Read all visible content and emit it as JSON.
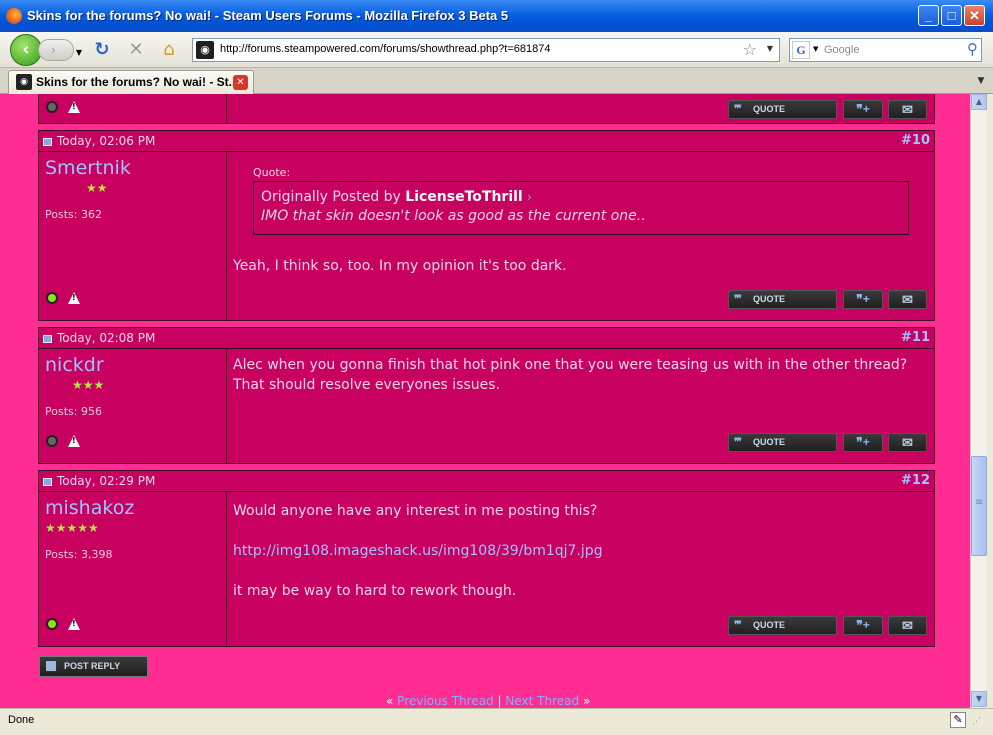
{
  "window": {
    "title": "Skins for the forums? No wai! - Steam Users Forums - Mozilla Firefox 3 Beta 5",
    "minimize": "_",
    "maximize": "□",
    "close": "✕"
  },
  "nav": {
    "url": "http://forums.steampowered.com/forums/showthread.php?t=681874",
    "search_placeholder": "Google"
  },
  "tab": {
    "label": "Skins for the forums? No wai! - St..."
  },
  "posts": [
    {
      "date": "Today, 02:06 PM",
      "number": "#10",
      "username": "Smertnik",
      "stars": "★★",
      "posts_label": "Posts: 362",
      "quote_label": "Quote:",
      "quote_prefix": "Originally Posted by",
      "quote_author": "LicenseToThrill",
      "quote_text": "IMO that skin doesn't look as good as the current one..",
      "body": "Yeah, I think so, too. In my opinion it's too dark.",
      "online": true
    },
    {
      "date": "Today, 02:08 PM",
      "number": "#11",
      "username": "nickdr",
      "stars": "★★★",
      "posts_label": "Posts: 956",
      "body_line1": "Alec when you gonna finish that hot pink one that you were teasing us with in the other thread?",
      "body_line2": "That should resolve everyones issues.",
      "online": false
    },
    {
      "date": "Today, 02:29 PM",
      "number": "#12",
      "username": "mishakoz",
      "stars": "★★★★★",
      "posts_label": "Posts: 3,398",
      "body_line1": "Would anyone have any interest in me posting this?",
      "link": "http://img108.imageshack.us/img108/39/bm1qj7.jpg",
      "body_line3": "it may be way to hard to rework though.",
      "online": true
    }
  ],
  "buttons": {
    "quote": "QUOTE",
    "multiquote": "❞+",
    "mail": "✉",
    "post_reply": "POST REPLY"
  },
  "thread_nav": {
    "prev_marker": "«",
    "prev": "Previous Thread",
    "separator": "|",
    "next": "Next Thread",
    "next_marker": "»"
  },
  "status": {
    "text": "Done"
  },
  "colors": {
    "page_bg": "#ff2d91",
    "post_bg": "#c8005f",
    "link": "#9fc3ff"
  }
}
